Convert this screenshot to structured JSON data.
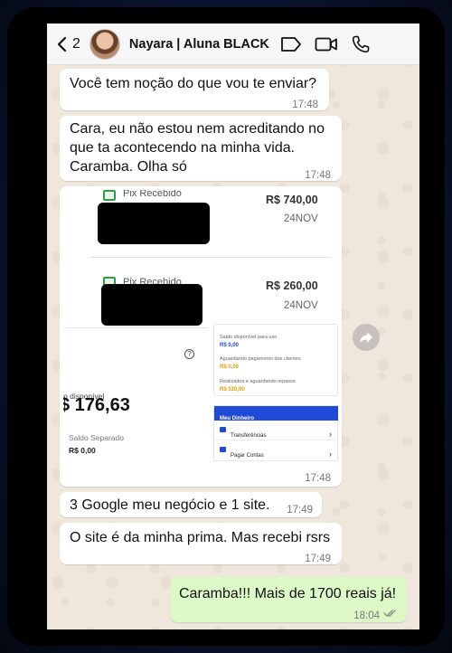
{
  "header": {
    "back_count": "2",
    "contact_name": "Nayara | Aluna BLACK"
  },
  "messages": [
    {
      "text": "Você tem noção do que vou te enviar?",
      "time": "17:48"
    },
    {
      "text": "Cara, eu não estou nem acreditando no\nque ta acontecendo na minha vida.\nCaramba. Olha só",
      "time": "17:48"
    },
    {
      "time": "17:48"
    },
    {
      "text": "3 Google meu negócio e 1 site.",
      "time": "17:49"
    },
    {
      "text": "O site é da minha prima. Mas recebi rsrs",
      "time": "17:49"
    },
    {
      "text": "Caramba!!! Mais de 1700 reais já!",
      "time": "18:04"
    }
  ],
  "screenshot": {
    "pix1": {
      "label": "Pix Recebido",
      "amount": "R$ 740,00",
      "date": "24NOV"
    },
    "pix2": {
      "label": "Pix Recebido",
      "amount": "R$ 260,00",
      "date": "24NOV"
    },
    "balance_label": "o disponível",
    "balance_value": "$ 176,63",
    "separated_label": "Saldo Separado",
    "separated_value": "R$ 0,00",
    "panel": [
      {
        "label": "Saldo disponível para uso",
        "value": "R$ 0,00",
        "color": "#1f4bd8"
      },
      {
        "label": "Aguardando pagamento dos clientes",
        "value": "R$ 0,00",
        "color": "#e0a100"
      },
      {
        "label": "Realizados e aguardando repasse",
        "value": "R$ 530,00",
        "color": "#e0a100"
      }
    ],
    "menu_title": "Meu Dinheiro",
    "menu_items": [
      "Transferências",
      "Pagar Contas"
    ]
  },
  "colors": {
    "outgoing_bubble": "#dcf8c6",
    "incoming_bubble": "#ffffff",
    "chat_background": "#efe7dc",
    "read_ticks": "#8a8a8a"
  }
}
